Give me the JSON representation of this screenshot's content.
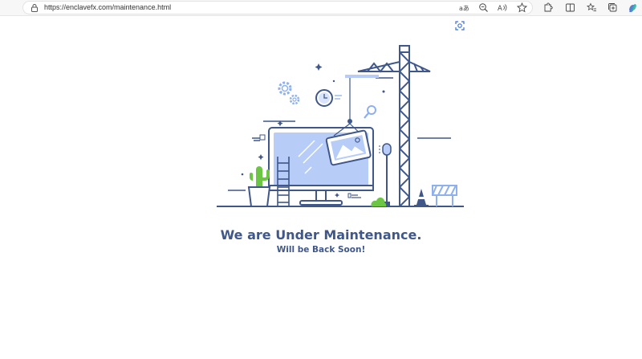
{
  "browser": {
    "url": "https://enclavefx.com/maintenance.html",
    "toolbar_icons": [
      "read-aloud-icon",
      "zoom-icon",
      "immersive-reader-icon",
      "favorite-star-icon",
      "extensions-icon",
      "split-screen-icon",
      "favorites-list-icon",
      "collections-icon",
      "copilot-icon"
    ],
    "page_icon": "screenshot-capture-icon"
  },
  "page": {
    "heading": "We are Under Maintenance.",
    "subheading": "Will be Back Soon!"
  },
  "colors": {
    "primary": "#3f5789",
    "illustration_light": "#b7cdf7",
    "plant_green": "#6cc644",
    "background": "#ffffff"
  }
}
